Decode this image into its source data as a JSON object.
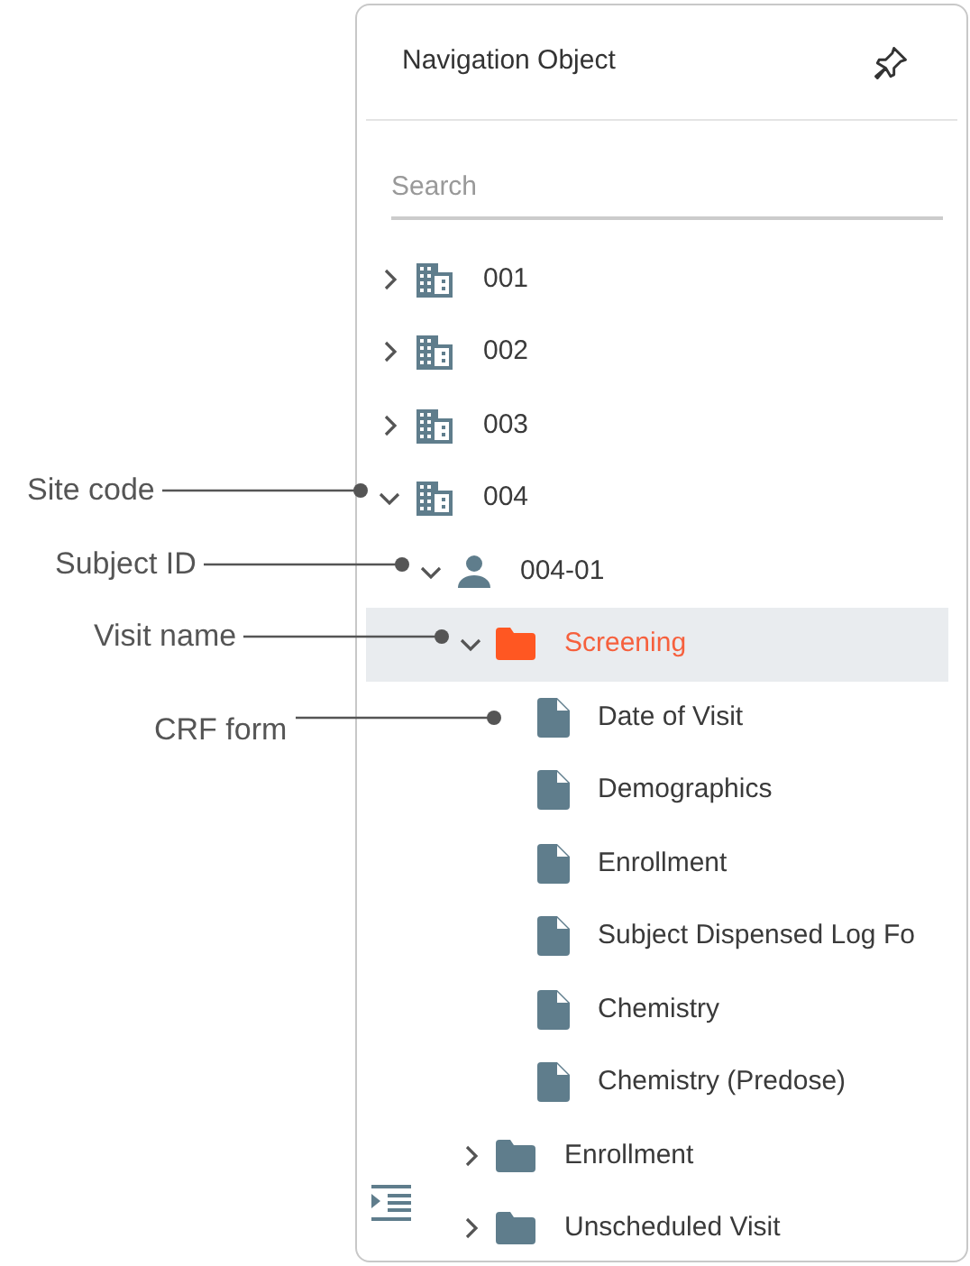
{
  "panel": {
    "title": "Navigation Object",
    "search": {
      "placeholder": "Search"
    },
    "tree": [
      {
        "kind": "site",
        "label": "001",
        "expanded": false,
        "selected": false
      },
      {
        "kind": "site",
        "label": "002",
        "expanded": false,
        "selected": false
      },
      {
        "kind": "site",
        "label": "003",
        "expanded": false,
        "selected": false
      },
      {
        "kind": "site",
        "label": "004",
        "expanded": true,
        "selected": false,
        "children": [
          {
            "kind": "subject",
            "label": "004-01",
            "expanded": true,
            "selected": false,
            "children": [
              {
                "kind": "visit",
                "label": "Screening",
                "expanded": true,
                "selected": true,
                "children": [
                  {
                    "kind": "form",
                    "label": "Date of Visit",
                    "selected": false
                  },
                  {
                    "kind": "form",
                    "label": "Demographics",
                    "selected": false
                  },
                  {
                    "kind": "form",
                    "label": "Enrollment",
                    "selected": false
                  },
                  {
                    "kind": "form",
                    "label": "Subject Dispensed Log Fo",
                    "selected": false
                  },
                  {
                    "kind": "form",
                    "label": "Chemistry",
                    "selected": false
                  },
                  {
                    "kind": "form",
                    "label": "Chemistry (Predose)",
                    "selected": false
                  }
                ]
              },
              {
                "kind": "visit",
                "label": "Enrollment",
                "expanded": false,
                "selected": false
              },
              {
                "kind": "visit",
                "label": "Unscheduled Visit",
                "expanded": false,
                "selected": false
              }
            ]
          }
        ]
      }
    ]
  },
  "annotations": [
    {
      "label": "Site code",
      "kind": "site"
    },
    {
      "label": "Subject ID",
      "kind": "subject"
    },
    {
      "label": "Visit name",
      "kind": "visit"
    },
    {
      "label": "CRF form",
      "kind": "form"
    }
  ]
}
